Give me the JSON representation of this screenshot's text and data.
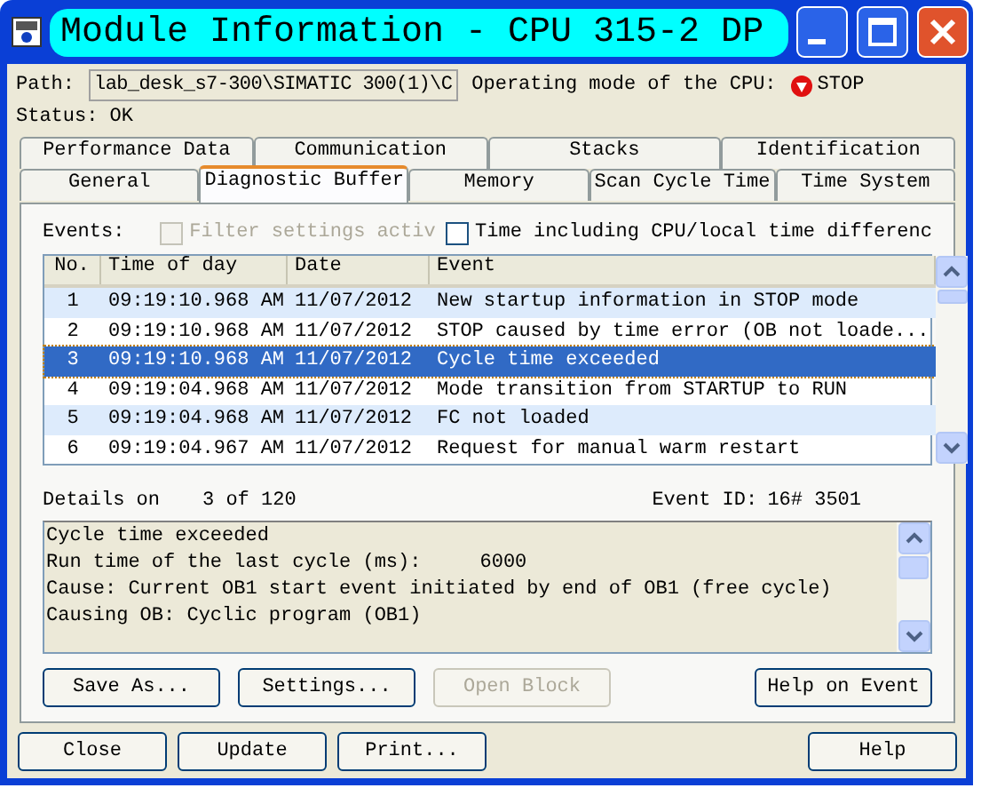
{
  "window": {
    "title": "Module Information - CPU 315-2 DP"
  },
  "path": {
    "label": "Path:",
    "value": "lab_desk_s7-300\\SIMATIC 300(1)\\C"
  },
  "operating_mode": {
    "label": "Operating mode of the  CPU:",
    "value": "STOP"
  },
  "status": "Status: OK",
  "tab_rows": [
    {
      "tabs": [
        {
          "label": "Performance Data",
          "selected": false
        },
        {
          "label": "Communication",
          "selected": false
        },
        {
          "label": "Stacks",
          "selected": false
        },
        {
          "label": "Identification",
          "selected": false
        }
      ]
    },
    {
      "tabs": [
        {
          "label": "General",
          "selected": false
        },
        {
          "label": "Diagnostic Buffer",
          "selected": true
        },
        {
          "label": "Memory",
          "selected": false
        },
        {
          "label": "Scan Cycle Time",
          "selected": false
        },
        {
          "label": "Time System",
          "selected": false
        }
      ]
    }
  ],
  "events_label": "Events:",
  "filter_checkbox": {
    "label": "Filter settings activ",
    "checked": false,
    "disabled": true
  },
  "time_checkbox": {
    "label": "Time including CPU/local time differenc",
    "checked": false
  },
  "table": {
    "columns": [
      "No.",
      "Time of day",
      "Date",
      "Event"
    ],
    "rows": [
      {
        "cells": [
          "1",
          "09:19:10.968 AM",
          "11/07/2012",
          "New startup information in STOP mode"
        ],
        "selected": false
      },
      {
        "cells": [
          "2",
          "09:19:10.968 AM",
          "11/07/2012",
          "STOP caused by time error (OB not loade..."
        ],
        "selected": false
      },
      {
        "cells": [
          "3",
          "09:19:10.968 AM",
          "11/07/2012",
          "Cycle time exceeded"
        ],
        "selected": true
      },
      {
        "cells": [
          "4",
          "09:19:04.968 AM",
          "11/07/2012",
          "Mode transition from STARTUP to RUN"
        ],
        "selected": false
      },
      {
        "cells": [
          "5",
          "09:19:04.968 AM",
          "11/07/2012",
          "FC not loaded"
        ],
        "selected": false
      },
      {
        "cells": [
          "6",
          "09:19:04.967 AM",
          "11/07/2012",
          "Request for manual warm restart"
        ],
        "selected": false
      }
    ]
  },
  "details": {
    "label": "Details on",
    "count": "3 of 120",
    "event_id_label": "Event ID:",
    "event_id": "16# 3501"
  },
  "details_lines": [
    "Cycle time exceeded",
    "Run time of the last cycle (ms):     6000",
    "Cause: Current OB1 start event initiated by end of OB1 (free cycle)",
    "Causing OB: Cyclic program (OB1)"
  ],
  "left_buttons": [
    {
      "label": "Save As...",
      "disabled": false
    },
    {
      "label": "Settings...",
      "disabled": false
    },
    {
      "label": "Open Block",
      "disabled": true
    }
  ],
  "right_buttons": [
    {
      "label": "Help on Event",
      "disabled": false
    }
  ],
  "footer_left_buttons": [
    {
      "label": "Close",
      "disabled": false
    },
    {
      "label": "Update",
      "disabled": false
    },
    {
      "label": "Print...",
      "disabled": false
    }
  ],
  "footer_right_buttons": [
    {
      "label": "Help",
      "disabled": false
    }
  ]
}
